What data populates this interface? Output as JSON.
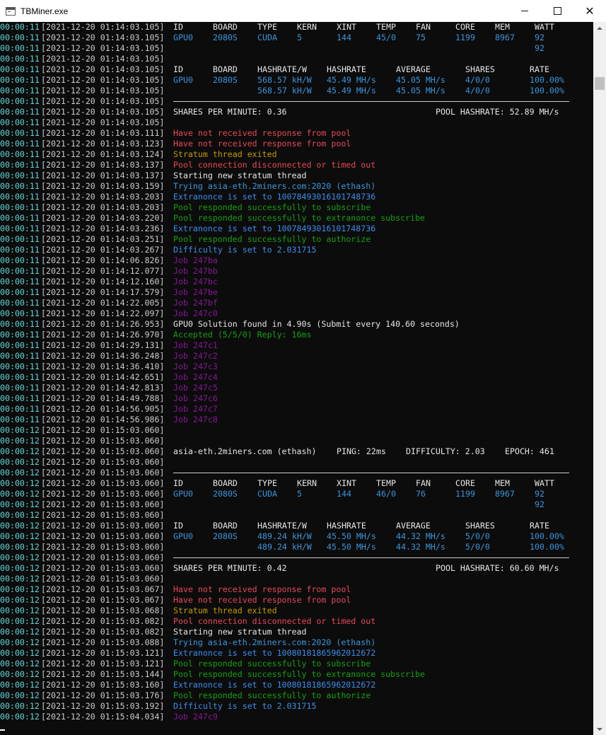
{
  "window": {
    "title": "TBMiner.exe"
  },
  "console_lines": [
    {
      "t": "00:00:11",
      "d": "[2021-12-20 01:14:03.105]",
      "k": "seg",
      "segs": [
        [
          "ID",
          "c-white",
          56
        ],
        [
          "BOARD",
          "c-white",
          63
        ],
        [
          "TYPE",
          "c-white",
          56
        ],
        [
          "KERN",
          "c-white",
          56
        ],
        [
          "XINT",
          "c-white",
          56
        ],
        [
          "TEMP",
          "c-white",
          56
        ],
        [
          "FAN",
          "c-white",
          56
        ],
        [
          "CORE",
          "c-white",
          56
        ],
        [
          "MEM",
          "c-white",
          56
        ],
        [
          "WATT",
          "c-white",
          50
        ]
      ]
    },
    {
      "t": "00:00:11",
      "d": "[2021-12-20 01:14:03.105]",
      "k": "seg",
      "segs": [
        [
          "GPU0",
          "c-cyan",
          56
        ],
        [
          "2080S",
          "c-cyan",
          63
        ],
        [
          "CUDA",
          "c-cyan",
          56
        ],
        [
          "5",
          "c-cyan",
          56
        ],
        [
          "144",
          "c-cyan",
          56
        ],
        [
          "45/0",
          "c-cyan",
          56
        ],
        [
          "75",
          "c-cyan",
          56
        ],
        [
          "1199",
          "c-cyan",
          56
        ],
        [
          "8967",
          "c-cyan",
          56
        ],
        [
          "92",
          "c-cyan",
          50
        ]
      ]
    },
    {
      "t": "00:00:11",
      "d": "[2021-12-20 01:14:03.105]",
      "k": "seg",
      "segs": [
        [
          "",
          "",
          511
        ],
        [
          "92",
          "c-cyan",
          50
        ]
      ]
    },
    {
      "t": "00:00:11",
      "d": "[2021-12-20 01:14:03.105]",
      "k": "text",
      "m": "",
      "c": ""
    },
    {
      "t": "00:00:11",
      "d": "[2021-12-20 01:14:03.105]",
      "k": "seg",
      "segs": [
        [
          "ID",
          "c-white",
          56
        ],
        [
          "BOARD",
          "c-white",
          63
        ],
        [
          "HASHRATE/W",
          "c-white",
          98
        ],
        [
          "HASHRATE",
          "c-white",
          98
        ],
        [
          "AVERAGE",
          "c-white",
          98
        ],
        [
          "SHARES",
          "c-white",
          91
        ],
        [
          "RATE",
          "c-white",
          70
        ]
      ]
    },
    {
      "t": "00:00:11",
      "d": "[2021-12-20 01:14:03.105]",
      "k": "seg",
      "segs": [
        [
          "GPU0",
          "c-cyan",
          56
        ],
        [
          "2080S",
          "c-cyan",
          63
        ],
        [
          "568.57 kH/W",
          "c-cyan",
          98
        ],
        [
          "45.49 MH/s",
          "c-cyan",
          98
        ],
        [
          "45.05 MH/s",
          "c-cyan",
          98
        ],
        [
          "4/0/0",
          "c-cyan",
          91
        ],
        [
          "100.00%",
          "c-cyan",
          70
        ]
      ]
    },
    {
      "t": "00:00:11",
      "d": "[2021-12-20 01:14:03.105]",
      "k": "seg",
      "segs": [
        [
          "",
          "",
          119
        ],
        [
          "568.57 kH/W",
          "c-cyan",
          98
        ],
        [
          "45.49 MH/s",
          "c-cyan",
          98
        ],
        [
          "45.05 MH/s",
          "c-cyan",
          98
        ],
        [
          "4/0/0",
          "c-cyan",
          91
        ],
        [
          "100.00%",
          "c-cyan",
          70
        ]
      ]
    },
    {
      "t": "00:00:11",
      "d": "[2021-12-20 01:14:03.105]",
      "k": "rule"
    },
    {
      "t": "00:00:11",
      "d": "[2021-12-20 01:14:03.105]",
      "k": "seg",
      "segs": [
        [
          "SHARES PER MINUTE: 0.36",
          "c-white",
          371
        ],
        [
          "POOL HASHRATE: 52.89 MH/s",
          "c-white",
          190
        ]
      ]
    },
    {
      "t": "00:00:11",
      "d": "[2021-12-20 01:14:03.105]",
      "k": "text",
      "m": "",
      "c": ""
    },
    {
      "t": "00:00:11",
      "d": "[2021-12-20 01:14:03.111]",
      "k": "text",
      "m": "Have not received response from pool",
      "c": "c-red"
    },
    {
      "t": "00:00:11",
      "d": "[2021-12-20 01:14:03.123]",
      "k": "text",
      "m": "Have not received response from pool",
      "c": "c-red"
    },
    {
      "t": "00:00:11",
      "d": "[2021-12-20 01:14:03.124]",
      "k": "text",
      "m": "Stratum thread exited",
      "c": "c-yellow"
    },
    {
      "t": "00:00:11",
      "d": "[2021-12-20 01:14:03.137]",
      "k": "text",
      "m": "Pool connection disconnected or timed out",
      "c": "c-red"
    },
    {
      "t": "00:00:11",
      "d": "[2021-12-20 01:14:03.137]",
      "k": "text",
      "m": "Starting new stratum thread",
      "c": "c-white"
    },
    {
      "t": "00:00:11",
      "d": "[2021-12-20 01:14:03.159]",
      "k": "text",
      "m": "Trying asia-eth.2miners.com:2020 (ethash)",
      "c": "c-cyan"
    },
    {
      "t": "00:00:11",
      "d": "[2021-12-20 01:14:03.203]",
      "k": "text",
      "m": "Extranonce is set to 10078493016101748736",
      "c": "c-blue"
    },
    {
      "t": "00:00:11",
      "d": "[2021-12-20 01:14:03.203]",
      "k": "text",
      "m": "Pool responded successfully to subscribe",
      "c": "c-green"
    },
    {
      "t": "00:00:11",
      "d": "[2021-12-20 01:14:03.220]",
      "k": "text",
      "m": "Pool responded successfully to extranonce subscribe",
      "c": "c-green"
    },
    {
      "t": "00:00:11",
      "d": "[2021-12-20 01:14:03.236]",
      "k": "text",
      "m": "Extranonce is set to 10078493016101748736",
      "c": "c-blue"
    },
    {
      "t": "00:00:11",
      "d": "[2021-12-20 01:14:03.251]",
      "k": "text",
      "m": "Pool responded successfully to authorize",
      "c": "c-green"
    },
    {
      "t": "00:00:11",
      "d": "[2021-12-20 01:14:03.267]",
      "k": "text",
      "m": "Difficulty is set to 2.031715",
      "c": "c-blue"
    },
    {
      "t": "00:00:11",
      "d": "[2021-12-20 01:14:06.826]",
      "k": "text",
      "m": "Job 247ba",
      "c": "c-purple"
    },
    {
      "t": "00:00:11",
      "d": "[2021-12-20 01:14:12.077]",
      "k": "text",
      "m": "Job 247bb",
      "c": "c-purple"
    },
    {
      "t": "00:00:11",
      "d": "[2021-12-20 01:14:12.160]",
      "k": "text",
      "m": "Job 247bc",
      "c": "c-purple"
    },
    {
      "t": "00:00:11",
      "d": "[2021-12-20 01:14:17.579]",
      "k": "text",
      "m": "Job 247be",
      "c": "c-purple"
    },
    {
      "t": "00:00:11",
      "d": "[2021-12-20 01:14:22.005]",
      "k": "text",
      "m": "Job 247bf",
      "c": "c-purple"
    },
    {
      "t": "00:00:11",
      "d": "[2021-12-20 01:14:22.097]",
      "k": "text",
      "m": "Job 247c0",
      "c": "c-purple"
    },
    {
      "t": "00:00:11",
      "d": "[2021-12-20 01:14:26.953]",
      "k": "text",
      "m": "GPU0 Solution found in 4.90s (Submit every 140.60 seconds)",
      "c": "c-white"
    },
    {
      "t": "00:00:11",
      "d": "[2021-12-20 01:14:26.970]",
      "k": "text",
      "m": "Accepted (5/5/0) Reply: 16ms",
      "c": "c-green"
    },
    {
      "t": "00:00:11",
      "d": "[2021-12-20 01:14:29.131]",
      "k": "text",
      "m": "Job 247c1",
      "c": "c-purple"
    },
    {
      "t": "00:00:11",
      "d": "[2021-12-20 01:14:36.248]",
      "k": "text",
      "m": "Job 247c2",
      "c": "c-purple"
    },
    {
      "t": "00:00:11",
      "d": "[2021-12-20 01:14:36.410]",
      "k": "text",
      "m": "Job 247c3",
      "c": "c-purple"
    },
    {
      "t": "00:00:11",
      "d": "[2021-12-20 01:14:42.651]",
      "k": "text",
      "m": "Job 247c4",
      "c": "c-purple"
    },
    {
      "t": "00:00:11",
      "d": "[2021-12-20 01:14:42.813]",
      "k": "text",
      "m": "Job 247c5",
      "c": "c-purple"
    },
    {
      "t": "00:00:11",
      "d": "[2021-12-20 01:14:49.788]",
      "k": "text",
      "m": "Job 247c6",
      "c": "c-purple"
    },
    {
      "t": "00:00:11",
      "d": "[2021-12-20 01:14:56.905]",
      "k": "text",
      "m": "Job 247c7",
      "c": "c-purple"
    },
    {
      "t": "00:00:11",
      "d": "[2021-12-20 01:14:56.986]",
      "k": "text",
      "m": "Job 247c8",
      "c": "c-purple"
    },
    {
      "t": "00:00:12",
      "d": "[2021-12-20 01:15:03.060]",
      "k": "text",
      "m": "",
      "c": ""
    },
    {
      "t": "00:00:12",
      "d": "[2021-12-20 01:15:03.060]",
      "k": "text",
      "m": "",
      "c": ""
    },
    {
      "t": "00:00:12",
      "d": "[2021-12-20 01:15:03.060]",
      "k": "seg",
      "segs": [
        [
          "asia-eth.2miners.com (ethash)",
          "c-white",
          231
        ],
        [
          "PING: 22ms",
          "c-white",
          98
        ],
        [
          "DIFFICULTY: 2.03",
          "c-white",
          140
        ],
        [
          "EPOCH: 461",
          "c-white",
          90
        ]
      ]
    },
    {
      "t": "00:00:12",
      "d": "[2021-12-20 01:15:03.060]",
      "k": "text",
      "m": "",
      "c": ""
    },
    {
      "t": "00:00:12",
      "d": "[2021-12-20 01:15:03.060]",
      "k": "rule"
    },
    {
      "t": "00:00:12",
      "d": "[2021-12-20 01:15:03.060]",
      "k": "seg",
      "segs": [
        [
          "ID",
          "c-white",
          56
        ],
        [
          "BOARD",
          "c-white",
          63
        ],
        [
          "TYPE",
          "c-white",
          56
        ],
        [
          "KERN",
          "c-white",
          56
        ],
        [
          "XINT",
          "c-white",
          56
        ],
        [
          "TEMP",
          "c-white",
          56
        ],
        [
          "FAN",
          "c-white",
          56
        ],
        [
          "CORE",
          "c-white",
          56
        ],
        [
          "MEM",
          "c-white",
          56
        ],
        [
          "WATT",
          "c-white",
          50
        ]
      ]
    },
    {
      "t": "00:00:12",
      "d": "[2021-12-20 01:15:03.060]",
      "k": "seg",
      "segs": [
        [
          "GPU0",
          "c-cyan",
          56
        ],
        [
          "2080S",
          "c-cyan",
          63
        ],
        [
          "CUDA",
          "c-cyan",
          56
        ],
        [
          "5",
          "c-cyan",
          56
        ],
        [
          "144",
          "c-cyan",
          56
        ],
        [
          "46/0",
          "c-cyan",
          56
        ],
        [
          "76",
          "c-cyan",
          56
        ],
        [
          "1199",
          "c-cyan",
          56
        ],
        [
          "8967",
          "c-cyan",
          56
        ],
        [
          "92",
          "c-cyan",
          50
        ]
      ]
    },
    {
      "t": "00:00:12",
      "d": "[2021-12-20 01:15:03.060]",
      "k": "seg",
      "segs": [
        [
          "",
          "",
          511
        ],
        [
          "92",
          "c-cyan",
          50
        ]
      ]
    },
    {
      "t": "00:00:12",
      "d": "[2021-12-20 01:15:03.060]",
      "k": "text",
      "m": "",
      "c": ""
    },
    {
      "t": "00:00:12",
      "d": "[2021-12-20 01:15:03.060]",
      "k": "seg",
      "segs": [
        [
          "ID",
          "c-white",
          56
        ],
        [
          "BOARD",
          "c-white",
          63
        ],
        [
          "HASHRATE/W",
          "c-white",
          98
        ],
        [
          "HASHRATE",
          "c-white",
          98
        ],
        [
          "AVERAGE",
          "c-white",
          98
        ],
        [
          "SHARES",
          "c-white",
          91
        ],
        [
          "RATE",
          "c-white",
          70
        ]
      ]
    },
    {
      "t": "00:00:12",
      "d": "[2021-12-20 01:15:03.060]",
      "k": "seg",
      "segs": [
        [
          "GPU0",
          "c-cyan",
          56
        ],
        [
          "2080S",
          "c-cyan",
          63
        ],
        [
          "489.24 kH/W",
          "c-cyan",
          98
        ],
        [
          "45.50 MH/s",
          "c-cyan",
          98
        ],
        [
          "44.32 MH/s",
          "c-cyan",
          98
        ],
        [
          "5/0/0",
          "c-cyan",
          91
        ],
        [
          "100.00%",
          "c-cyan",
          70
        ]
      ]
    },
    {
      "t": "00:00:12",
      "d": "[2021-12-20 01:15:03.060]",
      "k": "seg",
      "segs": [
        [
          "",
          "",
          119
        ],
        [
          "489.24 kH/W",
          "c-cyan",
          98
        ],
        [
          "45.50 MH/s",
          "c-cyan",
          98
        ],
        [
          "44.32 MH/s",
          "c-cyan",
          98
        ],
        [
          "5/0/0",
          "c-cyan",
          91
        ],
        [
          "100.00%",
          "c-cyan",
          70
        ]
      ]
    },
    {
      "t": "00:00:12",
      "d": "[2021-12-20 01:15:03.060]",
      "k": "rule"
    },
    {
      "t": "00:00:12",
      "d": "[2021-12-20 01:15:03.060]",
      "k": "seg",
      "segs": [
        [
          "SHARES PER MINUTE: 0.42",
          "c-white",
          371
        ],
        [
          "POOL HASHRATE: 60.60 MH/s",
          "c-white",
          190
        ]
      ]
    },
    {
      "t": "00:00:12",
      "d": "[2021-12-20 01:15:03.060]",
      "k": "text",
      "m": "",
      "c": ""
    },
    {
      "t": "00:00:12",
      "d": "[2021-12-20 01:15:03.067]",
      "k": "text",
      "m": "Have not received response from pool",
      "c": "c-red"
    },
    {
      "t": "00:00:12",
      "d": "[2021-12-20 01:15:03.067]",
      "k": "text",
      "m": "Have not received response from pool",
      "c": "c-red"
    },
    {
      "t": "00:00:12",
      "d": "[2021-12-20 01:15:03.068]",
      "k": "text",
      "m": "Stratum thread exited",
      "c": "c-yellow"
    },
    {
      "t": "00:00:12",
      "d": "[2021-12-20 01:15:03.082]",
      "k": "text",
      "m": "Pool connection disconnected or timed out",
      "c": "c-red"
    },
    {
      "t": "00:00:12",
      "d": "[2021-12-20 01:15:03.082]",
      "k": "text",
      "m": "Starting new stratum thread",
      "c": "c-white"
    },
    {
      "t": "00:00:12",
      "d": "[2021-12-20 01:15:03.088]",
      "k": "text",
      "m": "Trying asia-eth.2miners.com:2020 (ethash)",
      "c": "c-cyan"
    },
    {
      "t": "00:00:12",
      "d": "[2021-12-20 01:15:03.121]",
      "k": "text",
      "m": "Extranonce is set to 10080181865962012672",
      "c": "c-blue"
    },
    {
      "t": "00:00:12",
      "d": "[2021-12-20 01:15:03.121]",
      "k": "text",
      "m": "Pool responded successfully to subscribe",
      "c": "c-green"
    },
    {
      "t": "00:00:12",
      "d": "[2021-12-20 01:15:03.144]",
      "k": "text",
      "m": "Pool responded successfully to extranonce subscribe",
      "c": "c-green"
    },
    {
      "t": "00:00:12",
      "d": "[2021-12-20 01:15:03.160]",
      "k": "text",
      "m": "Extranonce is set to 10080181865962012672",
      "c": "c-blue"
    },
    {
      "t": "00:00:12",
      "d": "[2021-12-20 01:15:03.176]",
      "k": "text",
      "m": "Pool responded successfully to authorize",
      "c": "c-green"
    },
    {
      "t": "00:00:12",
      "d": "[2021-12-20 01:15:03.192]",
      "k": "text",
      "m": "Difficulty is set to 2.031715",
      "c": "c-blue"
    },
    {
      "t": "00:00:12",
      "d": "[2021-12-20 01:15:04.034]",
      "k": "text",
      "m": "Job 247c9",
      "c": "c-purple"
    }
  ],
  "scrollbar": {
    "position_fraction": 0.03
  }
}
